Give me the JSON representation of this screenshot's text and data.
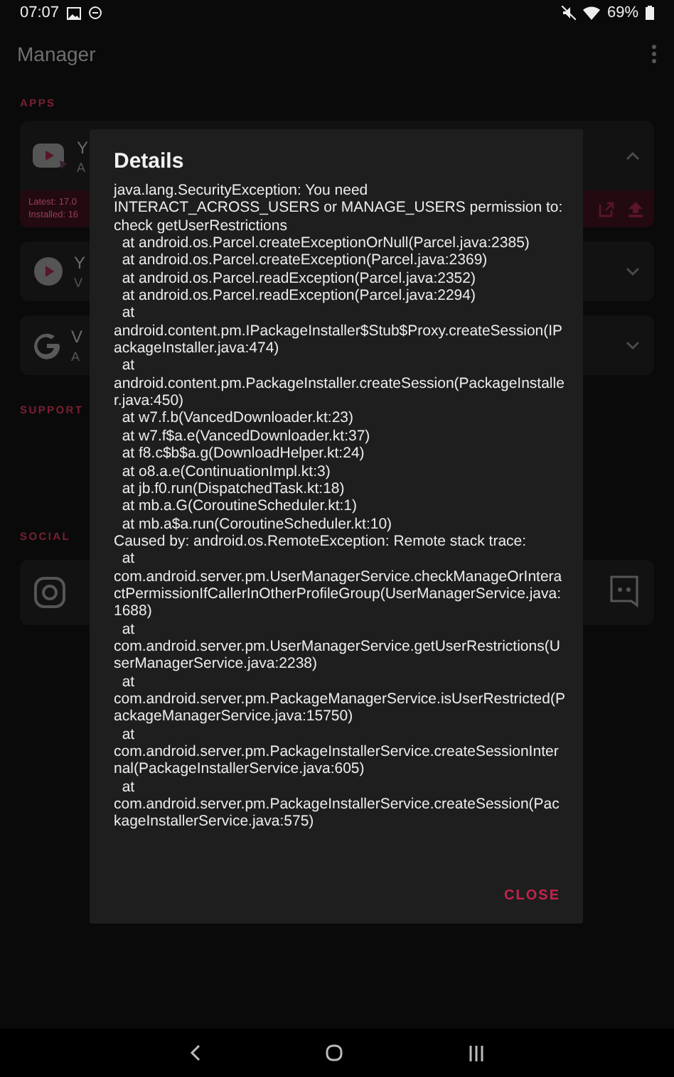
{
  "status_bar": {
    "time": "07:07",
    "battery": "69%"
  },
  "app_bar": {
    "title": "Manager"
  },
  "apps_section": {
    "header": "APPS",
    "apps": [
      {
        "kind": "youtube",
        "title": "Y",
        "subtitle": "A",
        "expanded": true,
        "latest": "Latest: 17.0",
        "installed": "Installed: 16"
      },
      {
        "kind": "music",
        "title": "Y",
        "subtitle": "V",
        "expanded": false
      },
      {
        "kind": "google",
        "title": "V",
        "subtitle": "A",
        "expanded": false
      }
    ]
  },
  "support_section": {
    "header": "SUPPORT"
  },
  "social_section": {
    "header": "SOCIAL"
  },
  "dialog": {
    "title": "Details",
    "message": "java.lang.SecurityException: You need INTERACT_ACROSS_USERS or MANAGE_USERS permission to: check getUserRestrictions\n  at android.os.Parcel.createExceptionOrNull(Parcel.java:2385)\n  at android.os.Parcel.createException(Parcel.java:2369)\n  at android.os.Parcel.readException(Parcel.java:2352)\n  at android.os.Parcel.readException(Parcel.java:2294)\n  at android.content.pm.IPackageInstaller$Stub$Proxy.createSession(IPackageInstaller.java:474)\n  at android.content.pm.PackageInstaller.createSession(PackageInstaller.java:450)\n  at w7.f.b(VancedDownloader.kt:23)\n  at w7.f$a.e(VancedDownloader.kt:37)\n  at f8.c$b$a.g(DownloadHelper.kt:24)\n  at o8.a.e(ContinuationImpl.kt:3)\n  at jb.f0.run(DispatchedTask.kt:18)\n  at mb.a.G(CoroutineScheduler.kt:1)\n  at mb.a$a.run(CoroutineScheduler.kt:10)\nCaused by: android.os.RemoteException: Remote stack trace:\n  at com.android.server.pm.UserManagerService.checkManageOrInteractPermissionIfCallerInOtherProfileGroup(UserManagerService.java:1688)\n  at com.android.server.pm.UserManagerService.getUserRestrictions(UserManagerService.java:2238)\n  at com.android.server.pm.PackageManagerService.isUserRestricted(PackageManagerService.java:15750)\n  at com.android.server.pm.PackageInstallerService.createSessionInternal(PackageInstallerService.java:605)\n  at com.android.server.pm.PackageInstallerService.createSession(PackageInstallerService.java:575)",
    "button": "CLOSE"
  }
}
